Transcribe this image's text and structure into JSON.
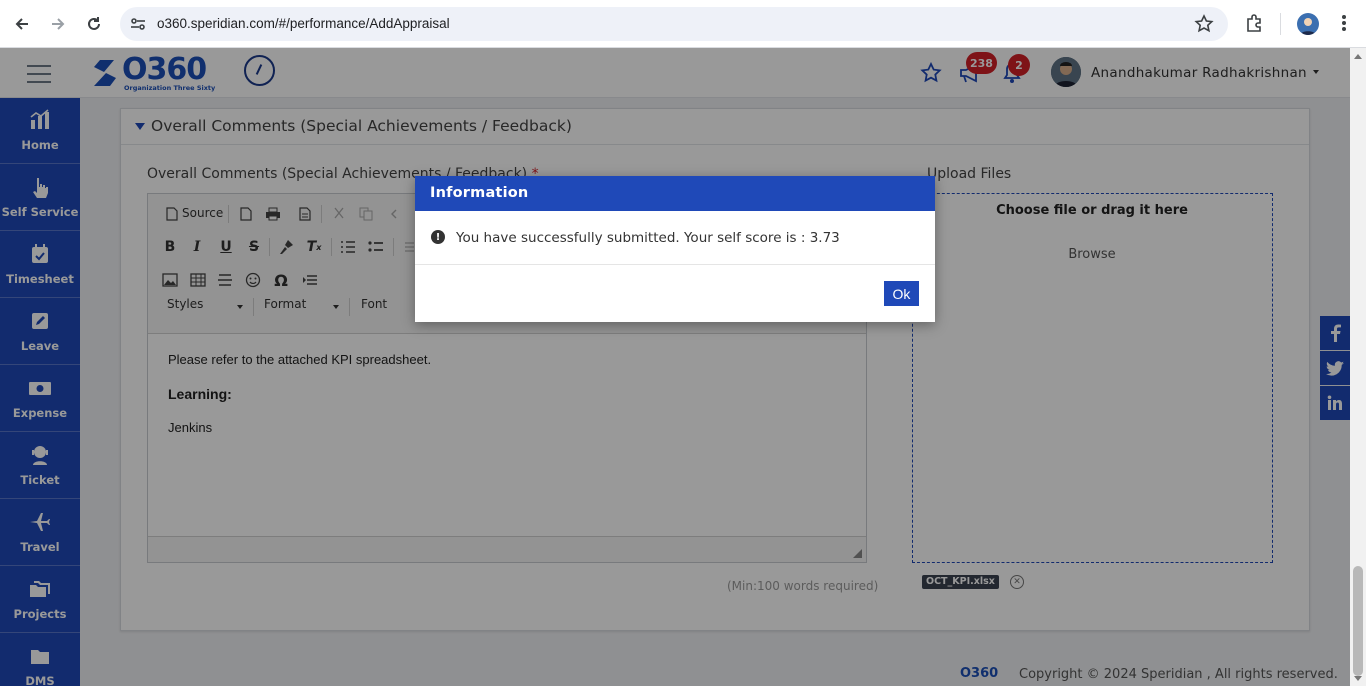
{
  "browser": {
    "url": "o360.speridian.com/#/performance/AddAppraisal"
  },
  "header": {
    "logo_text": "O360",
    "logo_subtitle": "Organization Three Sixty",
    "announcements_badge": "238",
    "notifications_badge": "2",
    "user_name": "Anandhakumar Radhakrishnan"
  },
  "sidebar": {
    "items": [
      {
        "label": "Home",
        "icon": "chart-icon"
      },
      {
        "label": "Self Service",
        "icon": "hand-pointer-icon"
      },
      {
        "label": "Timesheet",
        "icon": "calendar-icon"
      },
      {
        "label": "Leave",
        "icon": "edit-icon"
      },
      {
        "label": "Expense",
        "icon": "money-icon"
      },
      {
        "label": "Ticket",
        "icon": "headset-icon"
      },
      {
        "label": "Travel",
        "icon": "plane-icon"
      },
      {
        "label": "Projects",
        "icon": "folders-icon"
      },
      {
        "label": "DMS",
        "icon": "folder-icon"
      }
    ]
  },
  "panel": {
    "title": "Overall Comments (Special Achievements / Feedback)",
    "field_label": "Overall Comments (Special Achievements / Feedback)",
    "required_mark": "*",
    "upload_label": "Upload Files",
    "min_words": "(Min:100 words required)"
  },
  "editor": {
    "source_label": "Source",
    "styles_label": "Styles",
    "format_label": "Format",
    "font_label": "Font",
    "content": {
      "line1": "Please refer to the attached KPI spreadsheet.",
      "line2": "Learning:",
      "line3": "Jenkins"
    }
  },
  "dropzone": {
    "title": "Choose file or drag it here",
    "browse": "Browse",
    "file_name": "OCT_KPI.xlsx"
  },
  "footer": {
    "logo": "O360",
    "copyright": "Copyright © 2024 Speridian , All rights reserved."
  },
  "modal": {
    "title": "Information",
    "message": "You have successfully submitted. Your self score is : 3.73",
    "ok_label": "Ok"
  },
  "colors": {
    "brand_blue": "#1f49b8",
    "badge_red": "#d32027"
  }
}
